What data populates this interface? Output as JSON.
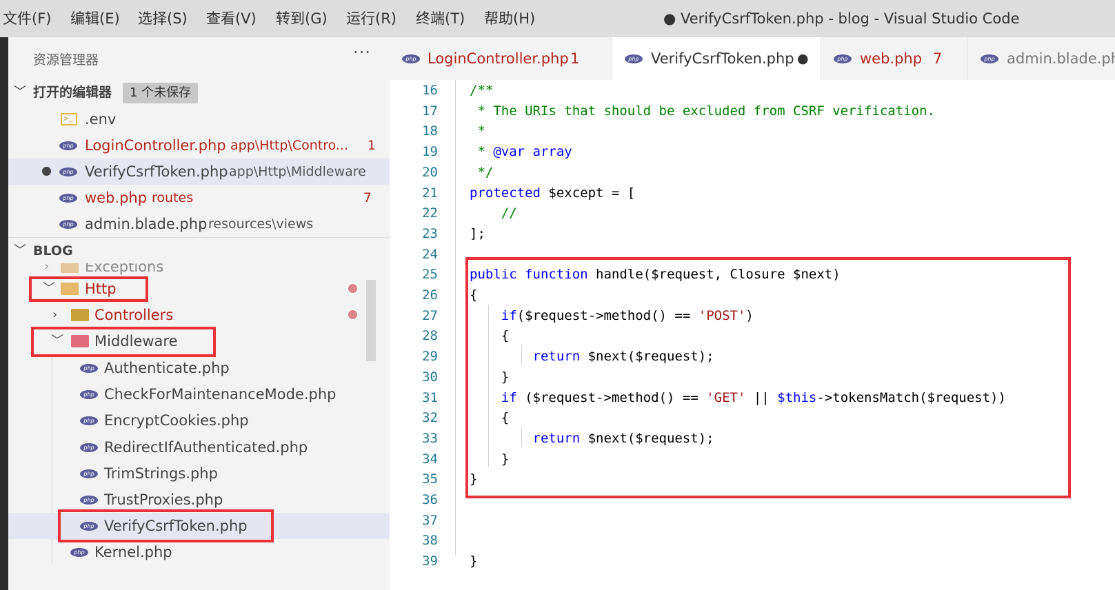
{
  "menu": {
    "items": [
      "文件(F)",
      "编辑(E)",
      "选择(S)",
      "查看(V)",
      "转到(G)",
      "运行(R)",
      "终端(T)",
      "帮助(H)"
    ],
    "window_title": "● VerifyCsrfToken.php - blog - Visual Studio Code"
  },
  "sidebar": {
    "title": "资源管理器",
    "more": "···",
    "open_editors": {
      "label": "打开的编辑器",
      "badge": "1 个未保存",
      "items": [
        {
          "name": ".env",
          "desc": "",
          "count": ""
        },
        {
          "name": "LoginController.php",
          "desc": "app\\Http\\Contro...",
          "count": "1"
        },
        {
          "name": "VerifyCsrfToken.php",
          "desc": "app\\Http\\Middleware",
          "count": ""
        },
        {
          "name": "web.php",
          "desc": "routes",
          "count": "7"
        },
        {
          "name": "admin.blade.php",
          "desc": "resources\\views",
          "count": ""
        }
      ]
    },
    "project": {
      "label": "BLOG",
      "items": [
        {
          "name": "Exceptions"
        },
        {
          "name": "Http"
        },
        {
          "name": "Controllers"
        },
        {
          "name": "Middleware"
        },
        {
          "name": "Authenticate.php"
        },
        {
          "name": "CheckForMaintenanceMode.php"
        },
        {
          "name": "EncryptCookies.php"
        },
        {
          "name": "RedirectIfAuthenticated.php"
        },
        {
          "name": "TrimStrings.php"
        },
        {
          "name": "TrustProxies.php"
        },
        {
          "name": "VerifyCsrfToken.php"
        },
        {
          "name": "Kernel.php"
        }
      ]
    }
  },
  "tabs": [
    {
      "label": "LoginController.php",
      "count": "1"
    },
    {
      "label": "VerifyCsrfToken.php",
      "dirty": "●"
    },
    {
      "label": "web.php",
      "count": "7"
    },
    {
      "label": "admin.blade.php"
    }
  ],
  "editor": {
    "line_numbers": [
      "16",
      "17",
      "18",
      "19",
      "20",
      "21",
      "22",
      "23",
      "24",
      "25",
      "26",
      "27",
      "28",
      "29",
      "30",
      "31",
      "32",
      "33",
      "34",
      "35",
      "36",
      "37",
      "38",
      "39"
    ],
    "lines": [
      [
        {
          "t": "/**",
          "c": "cm"
        }
      ],
      [
        {
          "t": " * The URIs that should be excluded from CSRF verification.",
          "c": "cm"
        }
      ],
      [
        {
          "t": " *",
          "c": "cm"
        }
      ],
      [
        {
          "t": " * ",
          "c": "cm"
        },
        {
          "t": "@var",
          "c": "cm-kw"
        },
        {
          "t": " array",
          "c": "cm-kw"
        }
      ],
      [
        {
          "t": " */",
          "c": "cm"
        }
      ],
      [
        {
          "t": "protected",
          "c": "kw"
        },
        {
          "t": " $except = [",
          "c": ""
        }
      ],
      [
        {
          "t": "    //",
          "c": "cm"
        }
      ],
      [
        {
          "t": "];",
          "c": ""
        }
      ],
      [
        {
          "t": "",
          "c": ""
        }
      ],
      [
        {
          "t": "public",
          "c": "kw"
        },
        {
          "t": " ",
          "c": ""
        },
        {
          "t": "function",
          "c": "kw"
        },
        {
          "t": " handle($request, Closure $next)",
          "c": ""
        }
      ],
      [
        {
          "t": "{",
          "c": ""
        }
      ],
      [
        {
          "t": "    ",
          "c": ""
        },
        {
          "t": "if",
          "c": "kw"
        },
        {
          "t": "($request->method() == ",
          "c": ""
        },
        {
          "t": "'POST'",
          "c": "str"
        },
        {
          "t": ")",
          "c": ""
        }
      ],
      [
        {
          "t": "    {",
          "c": ""
        }
      ],
      [
        {
          "t": "        ",
          "c": ""
        },
        {
          "t": "return",
          "c": "kw"
        },
        {
          "t": " $next($request);",
          "c": ""
        }
      ],
      [
        {
          "t": "    }",
          "c": ""
        }
      ],
      [
        {
          "t": "    ",
          "c": ""
        },
        {
          "t": "if",
          "c": "kw"
        },
        {
          "t": " ($request->method() == ",
          "c": ""
        },
        {
          "t": "'GET'",
          "c": "str"
        },
        {
          "t": " || ",
          "c": ""
        },
        {
          "t": "$this",
          "c": "kw"
        },
        {
          "t": "->tokensMatch($request))",
          "c": ""
        }
      ],
      [
        {
          "t": "    {",
          "c": ""
        }
      ],
      [
        {
          "t": "        ",
          "c": ""
        },
        {
          "t": "return",
          "c": "kw"
        },
        {
          "t": " $next($request);",
          "c": ""
        }
      ],
      [
        {
          "t": "    }",
          "c": ""
        }
      ],
      [
        {
          "t": "}",
          "c": ""
        }
      ],
      [
        {
          "t": "",
          "c": ""
        }
      ],
      [
        {
          "t": "",
          "c": ""
        }
      ],
      [
        {
          "t": "",
          "c": ""
        }
      ],
      [
        {
          "t": "}",
          "c": ""
        }
      ]
    ]
  },
  "colors": {
    "highlight_box": "#e8313a",
    "error_text": "#b3261e",
    "keyword": "#0000ff",
    "comment": "#008000",
    "string": "#a31515",
    "line_number": "#237893"
  }
}
